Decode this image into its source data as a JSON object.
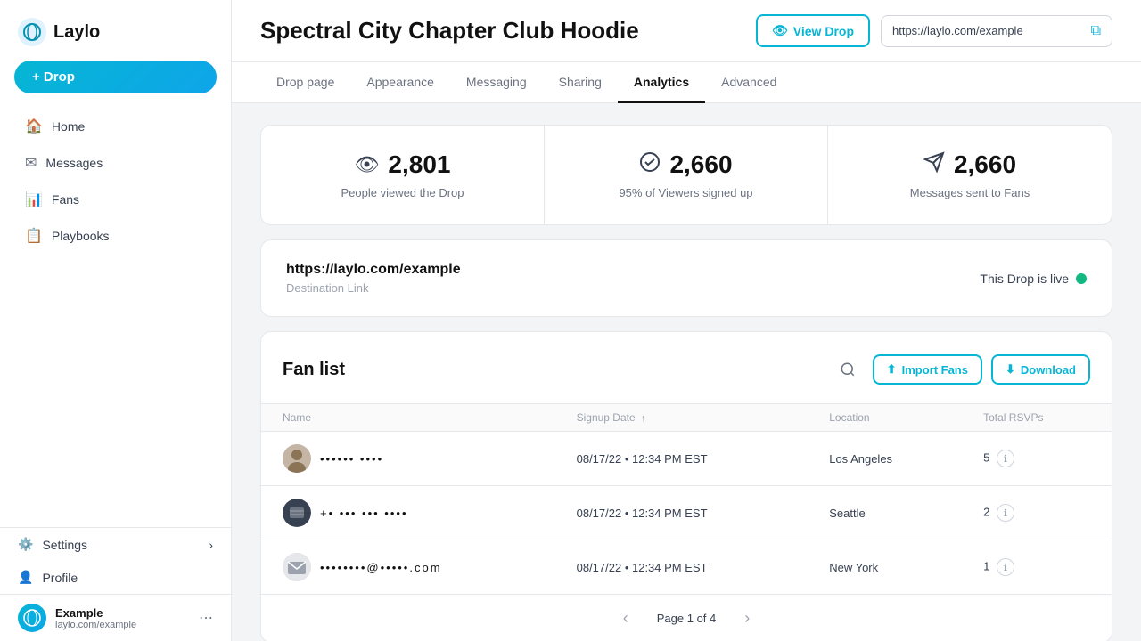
{
  "sidebar": {
    "logo_text": "Laylo",
    "drop_button_label": "+ Drop",
    "nav_items": [
      {
        "id": "home",
        "label": "Home",
        "icon": "🏠"
      },
      {
        "id": "messages",
        "label": "Messages",
        "icon": "✉"
      },
      {
        "id": "fans",
        "label": "Fans",
        "icon": "📊"
      },
      {
        "id": "playbooks",
        "label": "Playbooks",
        "icon": "📋"
      }
    ],
    "settings_label": "Settings",
    "profile_label": "Profile",
    "account": {
      "name": "Example",
      "url": "laylo.com/example"
    }
  },
  "header": {
    "title": "Spectral City Chapter Club Hoodie",
    "view_drop_label": "View Drop",
    "url": "https://laylo.com/example"
  },
  "tabs": [
    {
      "id": "drop-page",
      "label": "Drop page"
    },
    {
      "id": "appearance",
      "label": "Appearance"
    },
    {
      "id": "messaging",
      "label": "Messaging"
    },
    {
      "id": "sharing",
      "label": "Sharing"
    },
    {
      "id": "analytics",
      "label": "Analytics",
      "active": true
    },
    {
      "id": "advanced",
      "label": "Advanced"
    }
  ],
  "stats": [
    {
      "id": "views",
      "icon": "👁",
      "number": "2,801",
      "label": "People viewed the Drop"
    },
    {
      "id": "signups",
      "icon": "✅",
      "number": "2,660",
      "label": "95% of Viewers signed up"
    },
    {
      "id": "messages",
      "icon": "✈",
      "number": "2,660",
      "label": "Messages sent to Fans"
    }
  ],
  "destination": {
    "url": "https://laylo.com/example",
    "label": "Destination Link",
    "live_text": "This Drop is live"
  },
  "fan_list": {
    "title": "Fan list",
    "import_label": "Import Fans",
    "download_label": "Download",
    "columns": {
      "name": "Name",
      "signup_date": "Signup Date",
      "location": "Location",
      "total_rsvps": "Total RSVPs"
    },
    "rows": [
      {
        "id": 1,
        "avatar_type": "image",
        "name": "•••••• ••••",
        "signup_date": "08/17/22 • 12:34 PM EST",
        "location": "Los Angeles",
        "total_rsvps": "5"
      },
      {
        "id": 2,
        "avatar_type": "phone",
        "name": "+• ••• ••• ••••",
        "signup_date": "08/17/22 • 12:34 PM EST",
        "location": "Seattle",
        "total_rsvps": "2"
      },
      {
        "id": 3,
        "avatar_type": "email",
        "name": "••••••••@•••••.com",
        "signup_date": "08/17/22 • 12:34 PM EST",
        "location": "New York",
        "total_rsvps": "1"
      }
    ],
    "pagination": {
      "current_page": "Page 1 of 4"
    }
  }
}
